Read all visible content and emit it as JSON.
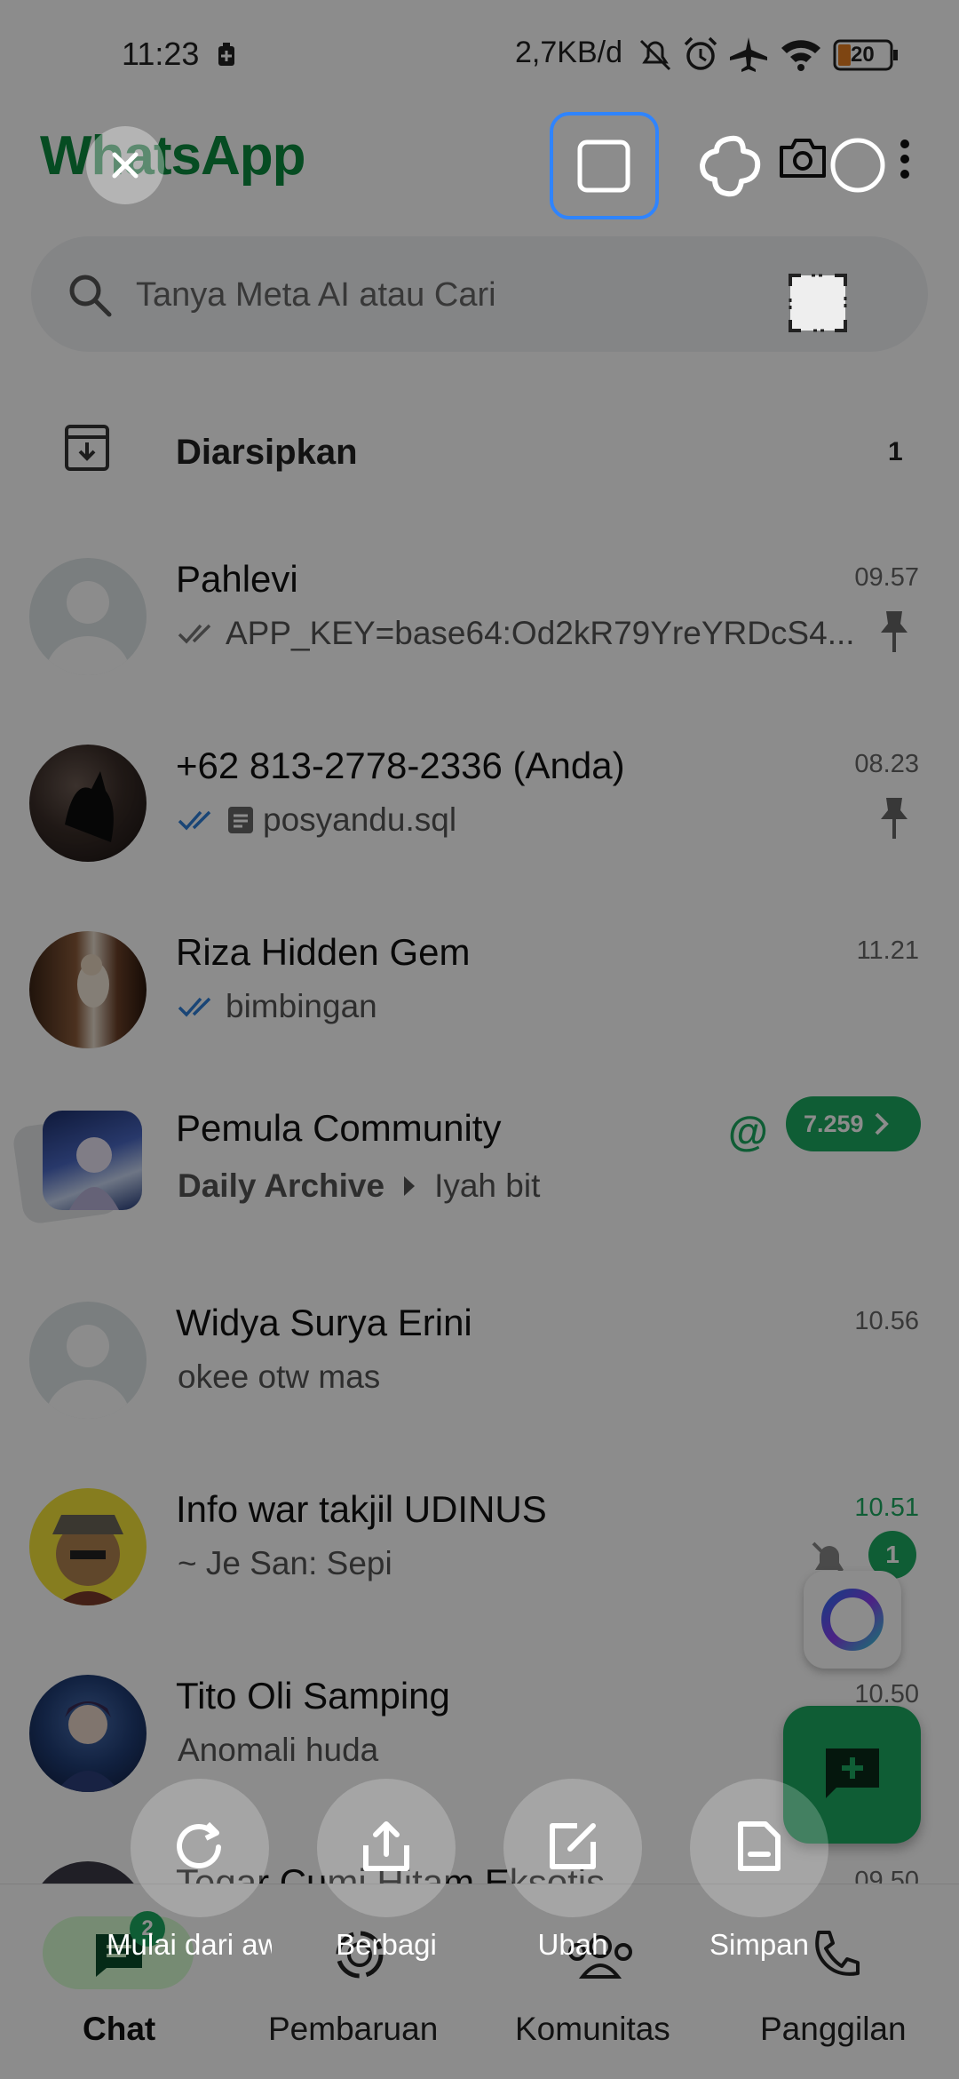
{
  "status_bar": {
    "time": "11:23",
    "speed": "2,7KB/d",
    "battery": "20",
    "icons": [
      "battery-saver-icon",
      "mute-icon",
      "alarm-icon",
      "airplane-icon",
      "wifi-icon",
      "battery-icon"
    ]
  },
  "header": {
    "title": "WhatsApp",
    "icons": [
      "camera-icon",
      "more-icon"
    ]
  },
  "search": {
    "placeholder": "Tanya Meta AI atau Cari"
  },
  "archived": {
    "label": "Diarsipkan",
    "count": "1"
  },
  "chats": [
    {
      "name": "Pahlevi",
      "time": "09.57",
      "preview": "APP_KEY=base64:Od2kR79YreYRDcS4...",
      "ticks": "read-grey",
      "pinned": true
    },
    {
      "name": "+62 813-2778-2336 (Anda)",
      "time": "08.23",
      "preview": "posyandu.sql",
      "ticks": "read-blue",
      "pinned": true,
      "doc": true
    },
    {
      "name": "Riza Hidden Gem",
      "time": "11.21",
      "preview": "bimbingan",
      "ticks": "read-blue"
    },
    {
      "name": "Pemula Community",
      "count": "7.259",
      "preview_a": "Daily Archive",
      "preview_b": "Iyah bit",
      "mention": "@"
    },
    {
      "name": "Widya Surya Erini",
      "time": "10.56",
      "preview": "okee otw mas"
    },
    {
      "name": "Info war takjil UDINUS",
      "time": "10.51",
      "preview": "~ Je San: Sepi",
      "unread": "1"
    },
    {
      "name": "Tito Oli Samping",
      "time": "10.50",
      "preview": "Anomali huda"
    },
    {
      "name": "Tegar Cumi Hitam Eksotis",
      "time": "09.50"
    }
  ],
  "bottom_nav": {
    "chat": "Chat",
    "chat_badge": "2",
    "updates": "Pembaruan",
    "communities": "Komunitas",
    "calls": "Panggilan"
  },
  "screenshot_tool": {
    "actions": [
      {
        "label": "Mulai dari awal",
        "icon": "restart-icon"
      },
      {
        "label": "Berbagi",
        "icon": "share-icon"
      },
      {
        "label": "Ubah",
        "icon": "edit-icon"
      },
      {
        "label": "Simpan",
        "icon": "save-icon"
      }
    ]
  },
  "colors": {
    "brand_green": "#0b8a3e",
    "fab_green": "#1daa61",
    "tick_blue": "#2f7fd8",
    "selection_blue": "#2f84ff"
  }
}
